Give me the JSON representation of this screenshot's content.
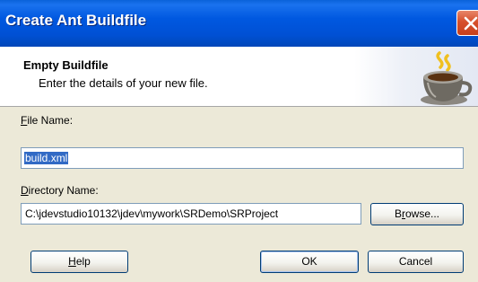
{
  "window": {
    "title": "Create Ant Buildfile",
    "close_icon": "close-icon"
  },
  "header": {
    "title": "Empty Buildfile",
    "subtitle": "Enter the details of your new file.",
    "icon": "coffee-cup-icon"
  },
  "form": {
    "file_name": {
      "label_mnemonic": "F",
      "label_rest": "ile Name:",
      "value": "build.xml"
    },
    "directory_name": {
      "label_mnemonic": "D",
      "label_rest": "irectory Name:",
      "value": "C:\\jdevstudio10132\\jdev\\mywork\\SRDemo\\SRProject"
    },
    "browse_button": {
      "pre": "B",
      "mnemonic": "r",
      "post": "owse..."
    }
  },
  "footer": {
    "help_button": {
      "mnemonic": "H",
      "rest": "elp"
    },
    "ok_button": "OK",
    "cancel_button": "Cancel"
  }
}
